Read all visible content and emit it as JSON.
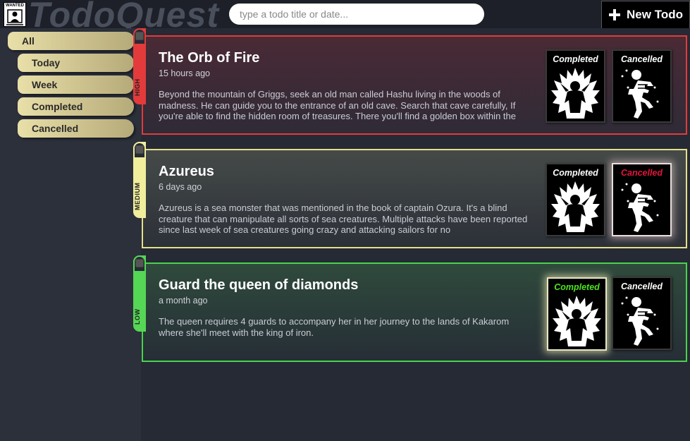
{
  "app": {
    "title": "TodoQuest",
    "logo_text": "WANTED"
  },
  "search": {
    "placeholder": "type a todo title or date..."
  },
  "new_button": {
    "label": "New Todo"
  },
  "sidebar": {
    "items": [
      {
        "label": "All"
      },
      {
        "label": "Today"
      },
      {
        "label": "Week"
      },
      {
        "label": "Completed"
      },
      {
        "label": "Cancelled"
      }
    ]
  },
  "todos": [
    {
      "priority": "HIGH",
      "title": "The Orb of Fire",
      "time": "15 hours ago",
      "description": "Beyond the mountain of Griggs, seek an old man called Hashu living in the woods of madness. He can guide you to the entrance of an old cave. Search that cave carefully, If you're able to find the hidden room of treasures. There you'll find a golden box within the",
      "completed_label": "Completed",
      "cancelled_label": "Cancelled",
      "status": "none"
    },
    {
      "priority": "MEDIUM",
      "title": "Azureus",
      "time": "6 days ago",
      "description": "Azureus is a sea monster that was mentioned in the book of captain Ozura. It's a blind creature that can manipulate all sorts of sea creatures. Multiple attacks have been reported since last week of sea creatures going crazy and attacking sailors for no",
      "completed_label": "Completed",
      "cancelled_label": "Cancelled",
      "status": "cancelled"
    },
    {
      "priority": "LOW",
      "title": "Guard the queen of diamonds",
      "time": "a month ago",
      "description": "The queen requires 4 guards to accompany her in her journey to the lands of Kakarom where she'll meet with the king of iron.",
      "completed_label": "Completed",
      "cancelled_label": "Cancelled",
      "status": "completed"
    }
  ],
  "colors": {
    "high": "#e33b3b",
    "medium": "#f1ee9c",
    "low": "#55d655",
    "completed_active": "#4ee31e",
    "cancelled_active": "#e3153a"
  }
}
